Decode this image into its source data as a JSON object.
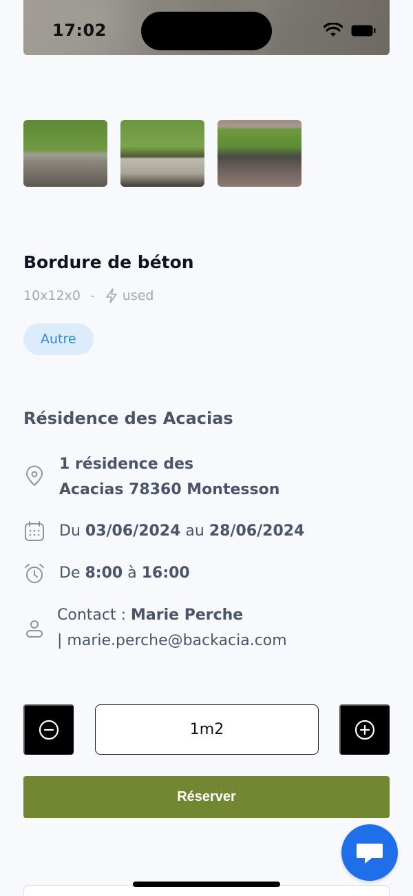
{
  "status_bar": {
    "time": "17:02"
  },
  "product": {
    "title": "Bordure de béton",
    "dimensions": "10x12x0",
    "separator": "-",
    "condition": "used",
    "tag": "Autre"
  },
  "site": {
    "name": "Résidence des Acacias",
    "address_line1": "1 résidence des",
    "address_line2": "Acacias 78360 Montesson",
    "dates_prefix": "Du",
    "date_from": "03/06/2024",
    "dates_mid": "au",
    "date_to": "28/06/2024",
    "hours_prefix": "De",
    "hour_from": "8:00",
    "hours_mid": "à",
    "hour_to": "16:00",
    "contact_label": "Contact :",
    "contact_name": "Marie Perche",
    "contact_email": "| marie.perche@backacia.com"
  },
  "quantity": {
    "value": "1m2"
  },
  "actions": {
    "reserve_label": "Réserver"
  },
  "colors": {
    "reserve_button": "#738632",
    "chat_button": "#1f6fe8",
    "tag_bg": "#dcecfb",
    "tag_text": "#2b8ad6"
  }
}
